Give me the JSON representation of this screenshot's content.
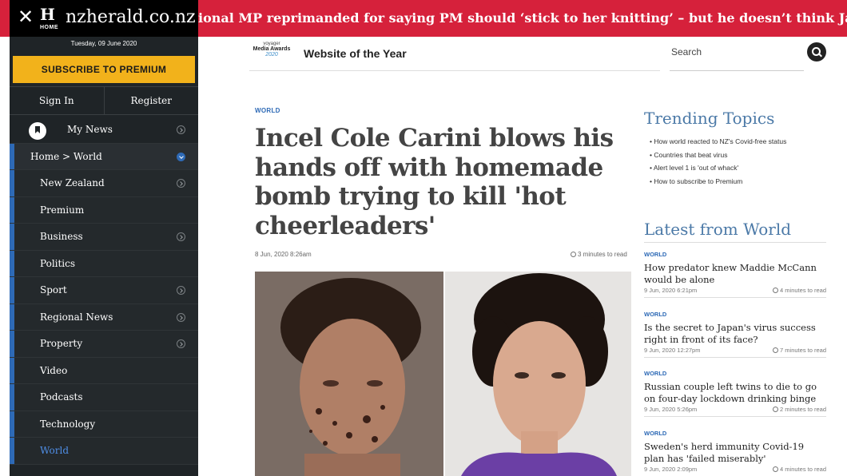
{
  "ticker": {
    "text": "ional MP reprimanded for saying PM should ‘stick to her knitting’ – but he doesn’t think Jacinda Ardern wo"
  },
  "nav": {
    "logo_letter": "H",
    "logo_home": "HOME",
    "logo_text": "nzherald.co.nz",
    "date": "Tuesday, 09 June 2020",
    "subscribe": "SUBSCRIBE TO PREMIUM",
    "sign_in": "Sign In",
    "register": "Register",
    "my_news": "My News",
    "breadcrumb": "Home > World",
    "items": [
      {
        "label": "New Zealand",
        "chevron": true
      },
      {
        "label": "Premium",
        "chevron": false
      },
      {
        "label": "Business",
        "chevron": true
      },
      {
        "label": "Politics",
        "chevron": false
      },
      {
        "label": "Sport",
        "chevron": true
      },
      {
        "label": "Regional News",
        "chevron": true
      },
      {
        "label": "Property",
        "chevron": true
      },
      {
        "label": "Video",
        "chevron": false
      },
      {
        "label": "Podcasts",
        "chevron": false
      },
      {
        "label": "Technology",
        "chevron": false
      },
      {
        "label": "World",
        "chevron": false,
        "active": true
      }
    ]
  },
  "header": {
    "award_small": "voyager",
    "award_name": "Media Awards",
    "award_year": "2020",
    "award_title": "Website of the Year",
    "search_label": "Search"
  },
  "article": {
    "section": "WORLD",
    "headline": "Incel Cole Carini blows his hands off with homemade bomb trying to kill 'hot cheerleaders'",
    "date": "8 Jun, 2020 8:26am",
    "read_time": "3 minutes to read"
  },
  "trending": {
    "title": "Trending Topics",
    "items": [
      "How world reacted to NZ's Covid-free status",
      "Countries that beat virus",
      "Alert level 1 is 'out of whack'",
      "How to subscribe to Premium"
    ]
  },
  "latest": {
    "title": "Latest from World",
    "stories": [
      {
        "tag": "WORLD",
        "title": "How predator knew Maddie McCann would be alone",
        "date": "9 Jun, 2020 6:21pm",
        "read": "4 minutes to read"
      },
      {
        "tag": "WORLD",
        "title": "Is the secret to Japan's virus success right in front of its face?",
        "date": "9 Jun, 2020 12:27pm",
        "read": "7 minutes to read"
      },
      {
        "tag": "WORLD",
        "title": "Russian couple left twins to die to go on four-day lockdown drinking binge",
        "date": "9 Jun, 2020 5:26pm",
        "read": "2 minutes to read"
      },
      {
        "tag": "WORLD",
        "title": "Sweden's herd immunity Covid-19 plan has 'failed miserably'",
        "date": "9 Jun, 2020 2:09pm",
        "read": "4 minutes to read"
      }
    ]
  },
  "colors": {
    "ticker_bg": "#d6213b",
    "nav_bg": "#1f2427",
    "subscribe_bg": "#f2b21b",
    "accent_blue": "#2e6ab6",
    "heading_blue": "#4b79a7"
  }
}
